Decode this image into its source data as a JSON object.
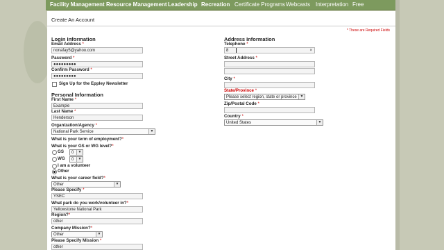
{
  "nav": [
    "Facility Management",
    "Resource Management",
    "Leadership",
    "Recreation",
    "Certificate Programs",
    "Webcasts",
    "Interpretation",
    "Free"
  ],
  "page_title": "Create An Account",
  "required_note": "* These are Required Fields",
  "login": {
    "heading": "Login Information",
    "email_label": "Email Address",
    "email_value": "nonafay5@yahoo.com",
    "password_label": "Password",
    "password_value": "●●●●●●●●●",
    "confirm_label": "Confirm Password",
    "confirm_value": "●●●●●●●●●",
    "newsletter_label": "Sign Up for the Eppley Newsletter"
  },
  "personal": {
    "heading": "Personal Information",
    "first_label": "First Name",
    "first_value": "Example",
    "last_label": "Last Name",
    "last_value": "Henderson",
    "org_label": "Organization/Agency",
    "org_value": "National Park Service",
    "term_label": "What is your term of employment?",
    "level_label": "What is your GS or WG level?",
    "gs_label": "GS",
    "gs_value": "0",
    "wg_label": "WG",
    "wg_value": "0",
    "volunteer_label": "I am a volunteer",
    "other_label": "Other",
    "career_label": "What is your career field?",
    "career_value": "Other",
    "specify_label": "Please Specify",
    "specify_value": "YSEC",
    "park_label": "What park do you work/volunteer in?",
    "park_value": "Yellowstone National Park",
    "region_label": "Region?",
    "region_value": "other",
    "mission_label": "Company Mission?",
    "mission_value": "Other",
    "mission_specify_label": "Please Specify Mission",
    "mission_specify_value": "other"
  },
  "address": {
    "heading": "Address Information",
    "telephone_label": "Telephone",
    "telephone_value": "8",
    "street_label": "Street Address",
    "city_label": "City",
    "state_label": "State/Province",
    "state_value": "Please select region, state or province",
    "zip_label": "Zip/Postal Code",
    "country_label": "Country",
    "country_value": "United States"
  },
  "colors": {
    "nav": "#7d9a5e",
    "required": "#cc0000",
    "background": "#c7c9b6"
  }
}
